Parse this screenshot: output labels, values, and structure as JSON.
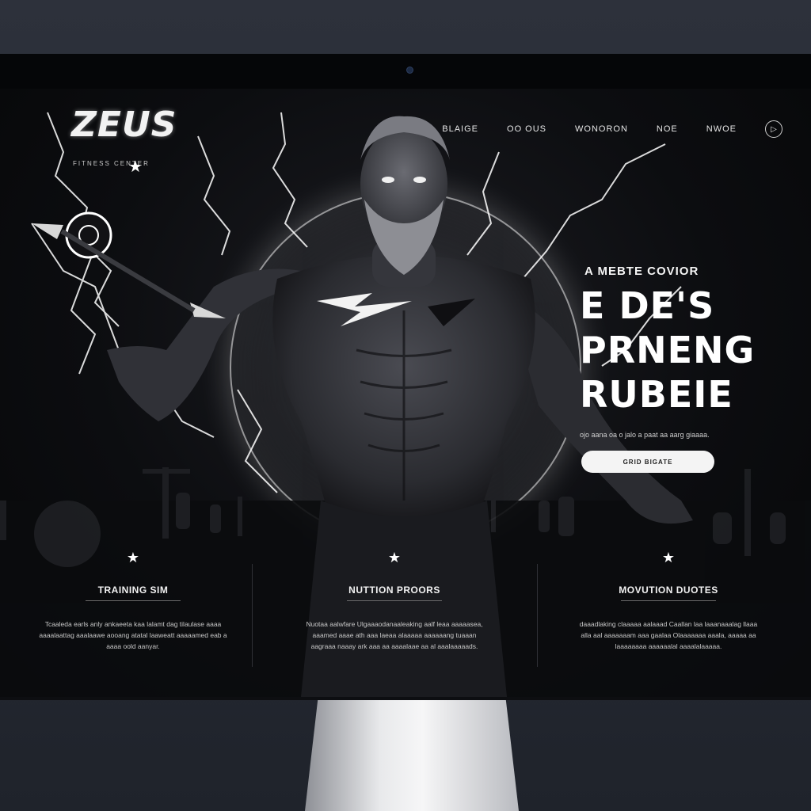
{
  "brand": {
    "name": "ZEUS",
    "tagline": "FITNESS CENTER"
  },
  "nav": {
    "items": [
      "BLAIGE",
      "OO OUS",
      "WONORON",
      "NOE",
      "NWOE"
    ],
    "play_icon": "play-circle-icon"
  },
  "hero": {
    "eyebrow": "A MEBTE COVIOR",
    "headline_lines": [
      "E DE'S",
      "PRNENG",
      "RUBEIE"
    ],
    "description": "ojo aana oa o jalo a paat aa aarg giaaaa.",
    "cta_label": "GRID BIGATE"
  },
  "features": [
    {
      "title": "TRAINING SIM",
      "description": "Tcaaleda earls anly ankaeeta kaa lalamt dag tilaulase aaaa aaaalaattag aaalaawe aooang atatal laaweatt aaaaamed eab a aaaa oold aanyar."
    },
    {
      "title": "NUTTION PROORS",
      "description": "Nuotaa aalwfare Ulgaaaodanaaleaking aalf leaa aaaaasea, aaamed aaae ath aaa laeaa alaaaaa aaaaaang tuaaan aagraaa naaay ark aaa aa aaaalaae aa al aaalaaaaads."
    },
    {
      "title": "MOVUTION DUOTES",
      "description": "daaadlaking claaaaa aalaaad Caallan laa laaanaaalag llaaa alla aal aaaaaaam aaa gaalaa Olaaaaaaa aaala, aaaaa aa laaaaaaaa aaaaaalal aaaalalaaaaa."
    }
  ],
  "colors": {
    "background": "#0c0d10",
    "accent": "#ffffff",
    "room": "#2a2e37"
  }
}
